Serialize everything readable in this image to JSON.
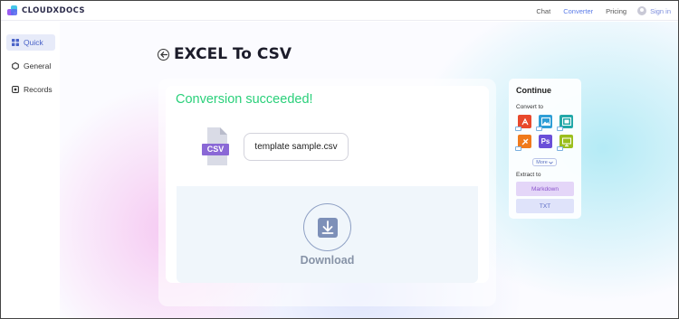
{
  "header": {
    "brand": "CLOUDXDOCS",
    "nav": [
      {
        "label": "Chat"
      },
      {
        "label": "Converter",
        "active": true
      },
      {
        "label": "Pricing"
      }
    ],
    "signin_label": "Sign in",
    "accent": "#5a7be8"
  },
  "sidebar": {
    "items": [
      {
        "label": "Quick",
        "icon": "grid-icon",
        "selected": true
      },
      {
        "label": "General",
        "icon": "hexagon-icon"
      },
      {
        "label": "Records",
        "icon": "records-icon"
      }
    ]
  },
  "page": {
    "title": "EXCEL To CSV"
  },
  "result": {
    "status": "Conversion succeeded!",
    "status_color": "#2ad07a",
    "file_badge": "CSV",
    "file_name": "template sample.csv",
    "download_label": "Download"
  },
  "continue": {
    "heading": "Continue",
    "convert_label": "Convert to",
    "formats": [
      {
        "icon": "pdf-icon",
        "color": "#e8492c"
      },
      {
        "icon": "image-icon",
        "color": "#2f9ed6"
      },
      {
        "icon": "slides-icon",
        "color": "#23a8a8"
      },
      {
        "icon": "ai-icon",
        "color": "#f07a1c"
      },
      {
        "icon": "photoshop-icon",
        "color": "#6a4fd8",
        "text": "Ps"
      },
      {
        "icon": "presentation-icon",
        "color": "#9bbf1e"
      }
    ],
    "more_label": "More",
    "extract_label": "Extract to",
    "extract": [
      {
        "label": "Markdown",
        "bg": "#e4d6f8",
        "color": "#8b55cc"
      },
      {
        "label": "TXT",
        "bg": "#dfe3fa",
        "color": "#5566c2"
      }
    ]
  }
}
